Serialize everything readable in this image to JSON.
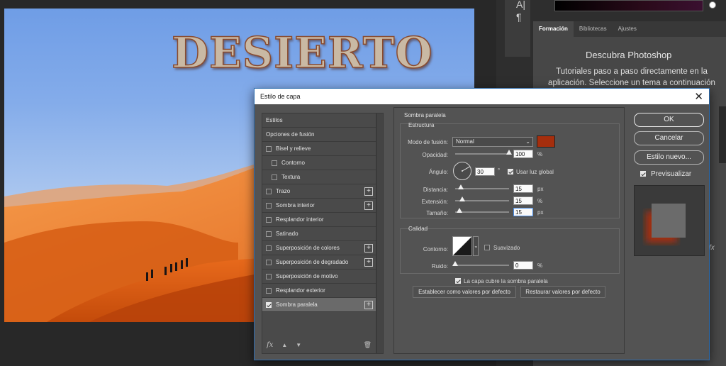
{
  "canvas": {
    "title_art": "DESIERTO"
  },
  "right_panel": {
    "tabs": [
      "Formación",
      "Bibliotecas",
      "Ajustes"
    ],
    "title": "Descubra Photoshop",
    "description": "Tutoriales paso a paso directamente en la aplicación. Seleccione un tema a continuación",
    "fx_peek": "fx"
  },
  "dialog": {
    "title": "Estilo de capa",
    "close": "✕",
    "styles_list": [
      {
        "label": "Estilos",
        "checkbox": false,
        "checked": false,
        "sub": false,
        "plus": false,
        "selected": false
      },
      {
        "label": "Opciones de fusión",
        "checkbox": false,
        "checked": false,
        "sub": false,
        "plus": false,
        "selected": false
      },
      {
        "label": "Bisel y relieve",
        "checkbox": true,
        "checked": false,
        "sub": false,
        "plus": false,
        "selected": false
      },
      {
        "label": "Contorno",
        "checkbox": true,
        "checked": false,
        "sub": true,
        "plus": false,
        "selected": false
      },
      {
        "label": "Textura",
        "checkbox": true,
        "checked": false,
        "sub": true,
        "plus": false,
        "selected": false
      },
      {
        "label": "Trazo",
        "checkbox": true,
        "checked": false,
        "sub": false,
        "plus": true,
        "selected": false
      },
      {
        "label": "Sombra interior",
        "checkbox": true,
        "checked": false,
        "sub": false,
        "plus": true,
        "selected": false
      },
      {
        "label": "Resplandor interior",
        "checkbox": true,
        "checked": false,
        "sub": false,
        "plus": false,
        "selected": false
      },
      {
        "label": "Satinado",
        "checkbox": true,
        "checked": false,
        "sub": false,
        "plus": false,
        "selected": false
      },
      {
        "label": "Superposición de colores",
        "checkbox": true,
        "checked": false,
        "sub": false,
        "plus": true,
        "selected": false
      },
      {
        "label": "Superposición de degradado",
        "checkbox": true,
        "checked": false,
        "sub": false,
        "plus": true,
        "selected": false
      },
      {
        "label": "Superposición de motivo",
        "checkbox": true,
        "checked": false,
        "sub": false,
        "plus": false,
        "selected": false
      },
      {
        "label": "Resplandor exterior",
        "checkbox": true,
        "checked": false,
        "sub": false,
        "plus": false,
        "selected": false
      },
      {
        "label": "Sombra paralela",
        "checkbox": true,
        "checked": true,
        "sub": false,
        "plus": true,
        "selected": true
      }
    ],
    "footer": {
      "fx": "fx",
      "up": "▲",
      "down": "▼",
      "trash": "🗑"
    },
    "section_title": "Sombra paralela",
    "structure": {
      "title": "Estructura",
      "blend_mode_label": "Modo de fusión:",
      "blend_mode_value": "Normal",
      "shadow_color": "#a52e0d",
      "opacity_label": "Opacidad:",
      "opacity_value": "100",
      "opacity_unit": "%",
      "opacity_level": 1.0,
      "angle_label": "Ángulo:",
      "angle_value": "30",
      "angle_unit": "°",
      "global_light_label": "Usar luz global",
      "global_light_checked": true,
      "distance_label": "Distancia:",
      "distance_value": "15",
      "distance_unit": "px",
      "spread_label": "Extensión:",
      "spread_value": "15",
      "spread_unit": "%",
      "size_label": "Tamaño:",
      "size_value": "15",
      "size_unit": "px"
    },
    "quality": {
      "title": "Calidad",
      "contour_label": "Contorno:",
      "antialias_label": "Suavizado",
      "antialias_checked": false,
      "noise_label": "Ruido:",
      "noise_value": "0",
      "noise_unit": "%"
    },
    "knockout_label": "La capa cubre la sombra paralela",
    "knockout_checked": true,
    "set_default": "Establecer como valores por defecto",
    "reset_default": "Restaurar valores por defecto",
    "buttons": {
      "ok": "OK",
      "cancel": "Cancelar",
      "new_style": "Estilo nuevo..."
    },
    "preview_label": "Previsualizar",
    "preview_checked": true
  }
}
